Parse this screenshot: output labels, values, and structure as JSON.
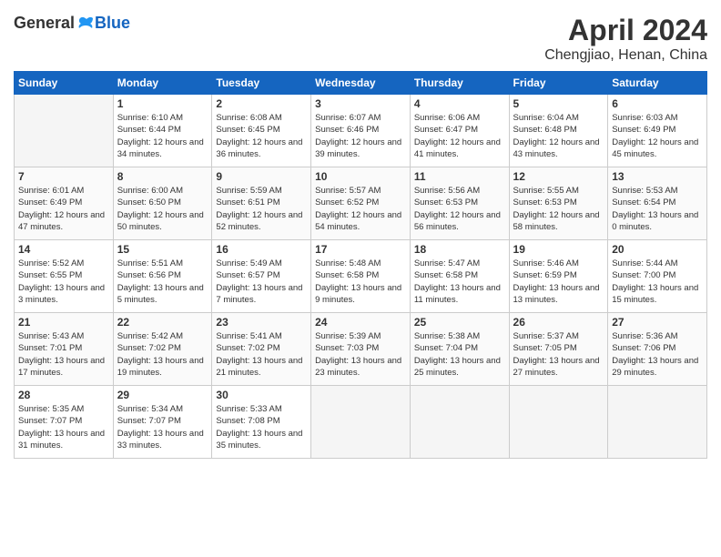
{
  "header": {
    "logo_general": "General",
    "logo_blue": "Blue",
    "title": "April 2024",
    "location": "Chengjiao, Henan, China"
  },
  "days_of_week": [
    "Sunday",
    "Monday",
    "Tuesday",
    "Wednesday",
    "Thursday",
    "Friday",
    "Saturday"
  ],
  "weeks": [
    [
      {
        "day": "",
        "empty": true
      },
      {
        "day": "1",
        "sunrise": "Sunrise: 6:10 AM",
        "sunset": "Sunset: 6:44 PM",
        "daylight": "Daylight: 12 hours and 34 minutes."
      },
      {
        "day": "2",
        "sunrise": "Sunrise: 6:08 AM",
        "sunset": "Sunset: 6:45 PM",
        "daylight": "Daylight: 12 hours and 36 minutes."
      },
      {
        "day": "3",
        "sunrise": "Sunrise: 6:07 AM",
        "sunset": "Sunset: 6:46 PM",
        "daylight": "Daylight: 12 hours and 39 minutes."
      },
      {
        "day": "4",
        "sunrise": "Sunrise: 6:06 AM",
        "sunset": "Sunset: 6:47 PM",
        "daylight": "Daylight: 12 hours and 41 minutes."
      },
      {
        "day": "5",
        "sunrise": "Sunrise: 6:04 AM",
        "sunset": "Sunset: 6:48 PM",
        "daylight": "Daylight: 12 hours and 43 minutes."
      },
      {
        "day": "6",
        "sunrise": "Sunrise: 6:03 AM",
        "sunset": "Sunset: 6:49 PM",
        "daylight": "Daylight: 12 hours and 45 minutes."
      }
    ],
    [
      {
        "day": "7",
        "sunrise": "Sunrise: 6:01 AM",
        "sunset": "Sunset: 6:49 PM",
        "daylight": "Daylight: 12 hours and 47 minutes."
      },
      {
        "day": "8",
        "sunrise": "Sunrise: 6:00 AM",
        "sunset": "Sunset: 6:50 PM",
        "daylight": "Daylight: 12 hours and 50 minutes."
      },
      {
        "day": "9",
        "sunrise": "Sunrise: 5:59 AM",
        "sunset": "Sunset: 6:51 PM",
        "daylight": "Daylight: 12 hours and 52 minutes."
      },
      {
        "day": "10",
        "sunrise": "Sunrise: 5:57 AM",
        "sunset": "Sunset: 6:52 PM",
        "daylight": "Daylight: 12 hours and 54 minutes."
      },
      {
        "day": "11",
        "sunrise": "Sunrise: 5:56 AM",
        "sunset": "Sunset: 6:53 PM",
        "daylight": "Daylight: 12 hours and 56 minutes."
      },
      {
        "day": "12",
        "sunrise": "Sunrise: 5:55 AM",
        "sunset": "Sunset: 6:53 PM",
        "daylight": "Daylight: 12 hours and 58 minutes."
      },
      {
        "day": "13",
        "sunrise": "Sunrise: 5:53 AM",
        "sunset": "Sunset: 6:54 PM",
        "daylight": "Daylight: 13 hours and 0 minutes."
      }
    ],
    [
      {
        "day": "14",
        "sunrise": "Sunrise: 5:52 AM",
        "sunset": "Sunset: 6:55 PM",
        "daylight": "Daylight: 13 hours and 3 minutes."
      },
      {
        "day": "15",
        "sunrise": "Sunrise: 5:51 AM",
        "sunset": "Sunset: 6:56 PM",
        "daylight": "Daylight: 13 hours and 5 minutes."
      },
      {
        "day": "16",
        "sunrise": "Sunrise: 5:49 AM",
        "sunset": "Sunset: 6:57 PM",
        "daylight": "Daylight: 13 hours and 7 minutes."
      },
      {
        "day": "17",
        "sunrise": "Sunrise: 5:48 AM",
        "sunset": "Sunset: 6:58 PM",
        "daylight": "Daylight: 13 hours and 9 minutes."
      },
      {
        "day": "18",
        "sunrise": "Sunrise: 5:47 AM",
        "sunset": "Sunset: 6:58 PM",
        "daylight": "Daylight: 13 hours and 11 minutes."
      },
      {
        "day": "19",
        "sunrise": "Sunrise: 5:46 AM",
        "sunset": "Sunset: 6:59 PM",
        "daylight": "Daylight: 13 hours and 13 minutes."
      },
      {
        "day": "20",
        "sunrise": "Sunrise: 5:44 AM",
        "sunset": "Sunset: 7:00 PM",
        "daylight": "Daylight: 13 hours and 15 minutes."
      }
    ],
    [
      {
        "day": "21",
        "sunrise": "Sunrise: 5:43 AM",
        "sunset": "Sunset: 7:01 PM",
        "daylight": "Daylight: 13 hours and 17 minutes."
      },
      {
        "day": "22",
        "sunrise": "Sunrise: 5:42 AM",
        "sunset": "Sunset: 7:02 PM",
        "daylight": "Daylight: 13 hours and 19 minutes."
      },
      {
        "day": "23",
        "sunrise": "Sunrise: 5:41 AM",
        "sunset": "Sunset: 7:02 PM",
        "daylight": "Daylight: 13 hours and 21 minutes."
      },
      {
        "day": "24",
        "sunrise": "Sunrise: 5:39 AM",
        "sunset": "Sunset: 7:03 PM",
        "daylight": "Daylight: 13 hours and 23 minutes."
      },
      {
        "day": "25",
        "sunrise": "Sunrise: 5:38 AM",
        "sunset": "Sunset: 7:04 PM",
        "daylight": "Daylight: 13 hours and 25 minutes."
      },
      {
        "day": "26",
        "sunrise": "Sunrise: 5:37 AM",
        "sunset": "Sunset: 7:05 PM",
        "daylight": "Daylight: 13 hours and 27 minutes."
      },
      {
        "day": "27",
        "sunrise": "Sunrise: 5:36 AM",
        "sunset": "Sunset: 7:06 PM",
        "daylight": "Daylight: 13 hours and 29 minutes."
      }
    ],
    [
      {
        "day": "28",
        "sunrise": "Sunrise: 5:35 AM",
        "sunset": "Sunset: 7:07 PM",
        "daylight": "Daylight: 13 hours and 31 minutes."
      },
      {
        "day": "29",
        "sunrise": "Sunrise: 5:34 AM",
        "sunset": "Sunset: 7:07 PM",
        "daylight": "Daylight: 13 hours and 33 minutes."
      },
      {
        "day": "30",
        "sunrise": "Sunrise: 5:33 AM",
        "sunset": "Sunset: 7:08 PM",
        "daylight": "Daylight: 13 hours and 35 minutes."
      },
      {
        "day": "",
        "empty": true
      },
      {
        "day": "",
        "empty": true
      },
      {
        "day": "",
        "empty": true
      },
      {
        "day": "",
        "empty": true
      }
    ]
  ]
}
